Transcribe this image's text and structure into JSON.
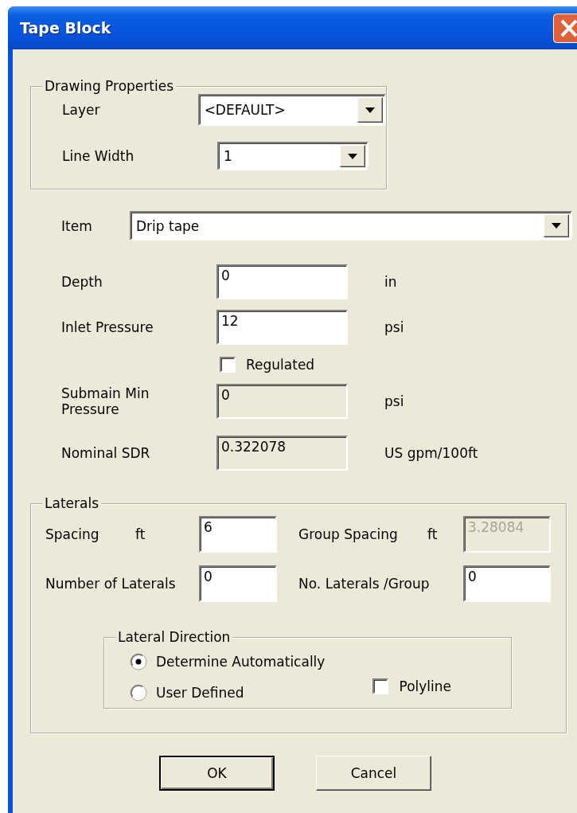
{
  "window": {
    "title": "Tape Block"
  },
  "drawing_properties": {
    "title": "Drawing Properties",
    "combos": [
      {
        "label": "Layer",
        "value": "<DEFAULT>"
      },
      {
        "label": "Line Width",
        "value": "1"
      }
    ]
  },
  "item": {
    "label": "Item",
    "value": "Drip tape"
  },
  "fields": [
    {
      "kind": "input",
      "label": "Depth",
      "value": "0",
      "unit": "in",
      "readonly": false
    },
    {
      "kind": "input",
      "label": "Inlet Pressure",
      "value": "12",
      "unit": "psi",
      "readonly": false
    },
    {
      "kind": "checkbox",
      "label": "Regulated",
      "checked": false
    },
    {
      "kind": "input",
      "label": "Submain Min Pressure",
      "value": "0",
      "unit": "psi",
      "readonly": true
    },
    {
      "kind": "input",
      "label": "Nominal SDR",
      "value": "0.322078",
      "unit": "US gpm/100ft",
      "readonly": true
    }
  ],
  "laterals": {
    "title": "Laterals",
    "rows": [
      [
        {
          "label": "Spacing",
          "unit": "ft",
          "value": "6",
          "disabled": false
        },
        {
          "label": "Group Spacing",
          "unit": "ft",
          "value": "3.28084",
          "disabled": true
        }
      ],
      [
        {
          "label": "Number of Laterals",
          "value": "0",
          "disabled": false
        },
        {
          "label": "No. Laterals /Group",
          "value": "0",
          "disabled": false
        }
      ]
    ],
    "direction": {
      "title": "Lateral Direction",
      "options": [
        {
          "label": "Determine Automatically",
          "selected": true
        },
        {
          "label": "User Defined",
          "selected": false
        }
      ],
      "polyline": {
        "label": "Polyline",
        "checked": false
      }
    }
  },
  "buttons": [
    {
      "label": "OK",
      "default": true
    },
    {
      "label": "Cancel",
      "default": false
    }
  ]
}
